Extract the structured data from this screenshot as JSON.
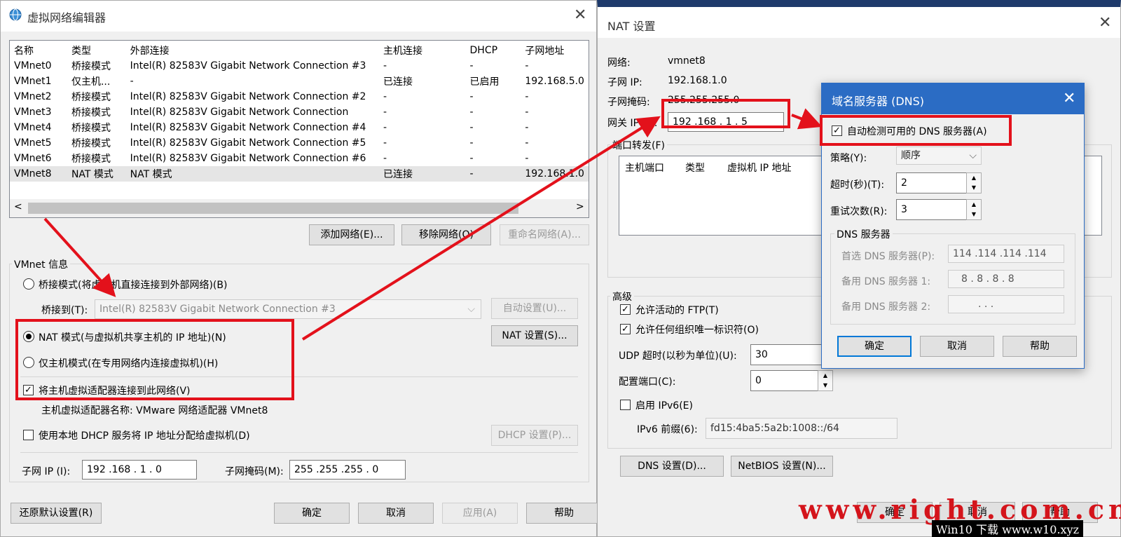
{
  "vne": {
    "title": "虚拟网络编辑器",
    "columns": [
      "名称",
      "类型",
      "外部连接",
      "主机连接",
      "DHCP",
      "子网地址"
    ],
    "rows": [
      [
        "VMnet0",
        "桥接模式",
        "Intel(R) 82583V Gigabit Network Connection #3",
        "-",
        "-",
        "-"
      ],
      [
        "VMnet1",
        "仅主机...",
        "-",
        "已连接",
        "已启用",
        "192.168.5.0"
      ],
      [
        "VMnet2",
        "桥接模式",
        "Intel(R) 82583V Gigabit Network Connection #2",
        "-",
        "-",
        "-"
      ],
      [
        "VMnet3",
        "桥接模式",
        "Intel(R) 82583V Gigabit Network Connection",
        "-",
        "-",
        "-"
      ],
      [
        "VMnet4",
        "桥接模式",
        "Intel(R) 82583V Gigabit Network Connection #4",
        "-",
        "-",
        "-"
      ],
      [
        "VMnet5",
        "桥接模式",
        "Intel(R) 82583V Gigabit Network Connection #5",
        "-",
        "-",
        "-"
      ],
      [
        "VMnet6",
        "桥接模式",
        "Intel(R) 82583V Gigabit Network Connection #6",
        "-",
        "-",
        "-"
      ],
      [
        "VMnet8",
        "NAT 模式",
        "NAT 模式",
        "已连接",
        "-",
        "192.168.1.0"
      ]
    ],
    "add_network": "添加网络(E)...",
    "remove_network": "移除网络(O)",
    "rename_network": "重命名网络(A)...",
    "info_group": "VMnet 信息",
    "bridge_mode": "桥接模式(将虚拟机直接连接到外部网络)(B)",
    "bridge_to_label": "桥接到(T):",
    "bridge_to_value": "Intel(R) 82583V Gigabit Network Connection #3",
    "auto_settings": "自动设置(U)...",
    "nat_mode": "NAT 模式(与虚拟机共享主机的 IP 地址)(N)",
    "nat_settings": "NAT 设置(S)...",
    "host_only": "仅主机模式(在专用网络内连接虚拟机)(H)",
    "connect_adapter": "将主机虚拟适配器连接到此网络(V)",
    "adapter_name": "主机虚拟适配器名称: VMware 网络适配器 VMnet8",
    "use_dhcp": "使用本地 DHCP 服务将 IP 地址分配给虚拟机(D)",
    "dhcp_settings": "DHCP 设置(P)...",
    "subnet_ip_label": "子网 IP (I):",
    "subnet_ip": "192 .168 .  1  .  0",
    "subnet_mask_label": "子网掩码(M):",
    "subnet_mask": "255 .255 .255 .  0",
    "restore_defaults": "还原默认设置(R)",
    "ok": "确定",
    "cancel": "取消",
    "apply": "应用(A)",
    "help": "帮助"
  },
  "nat": {
    "title": "NAT 设置",
    "network_label": "网络:",
    "network_value": "vmnet8",
    "subnet_ip_label": "子网 IP:",
    "subnet_ip_value": "192.168.1.0",
    "subnet_mask_label": "子网掩码:",
    "subnet_mask_value": "255.255.255.0",
    "gateway_label": "网关 IP(G):",
    "gateway_value": "192 .168 .  1  .  5",
    "port_forward_label": "端口转发(F)",
    "pf_columns": [
      "主机端口",
      "类型",
      "虚拟机 IP 地址"
    ],
    "advanced_label": "高级",
    "allow_ftp": "允许活动的 FTP(T)",
    "allow_any_oui": "允许任何组织唯一标识符(O)",
    "udp_timeout_label": "UDP 超时(以秒为单位)(U):",
    "udp_timeout_value": "30",
    "config_port_label": "配置端口(C):",
    "config_port_value": "0",
    "enable_ipv6": "启用 IPv6(E)",
    "ipv6_prefix_label": "IPv6 前缀(6):",
    "ipv6_prefix_value": "fd15:4ba5:5a2b:1008::/64",
    "dns_settings": "DNS 设置(D)...",
    "netbios_settings": "NetBIOS 设置(N)...",
    "ok": "确定",
    "cancel": "取消",
    "help": "帮助"
  },
  "dns": {
    "title": "域名服务器 (DNS)",
    "auto_detect": "自动检测可用的 DNS 服务器(A)",
    "policy_label": "策略(Y):",
    "policy_value": "顺序",
    "timeout_label": "超时(秒)(T):",
    "timeout_value": "2",
    "retry_label": "重试次数(R):",
    "retry_value": "3",
    "servers_group": "DNS 服务器",
    "preferred_label": "首选 DNS 服务器(P):",
    "preferred_value": "114 .114 .114 .114",
    "alt1_label": "备用 DNS 服务器 1:",
    "alt1_value": "8  .  8  .  8  .  8",
    "alt2_label": "备用 DNS 服务器 2:",
    "alt2_value": ".       .       .",
    "ok": "确定",
    "cancel": "取消",
    "help": "帮助"
  },
  "watermark": {
    "big": "www.right.com.cn",
    "small": "Win10 下载 www.w10.xyz"
  },
  "colors": {
    "highlight": "#e3111b",
    "accent": "#0078d7",
    "dns_title_bg": "#2b6cc4"
  }
}
